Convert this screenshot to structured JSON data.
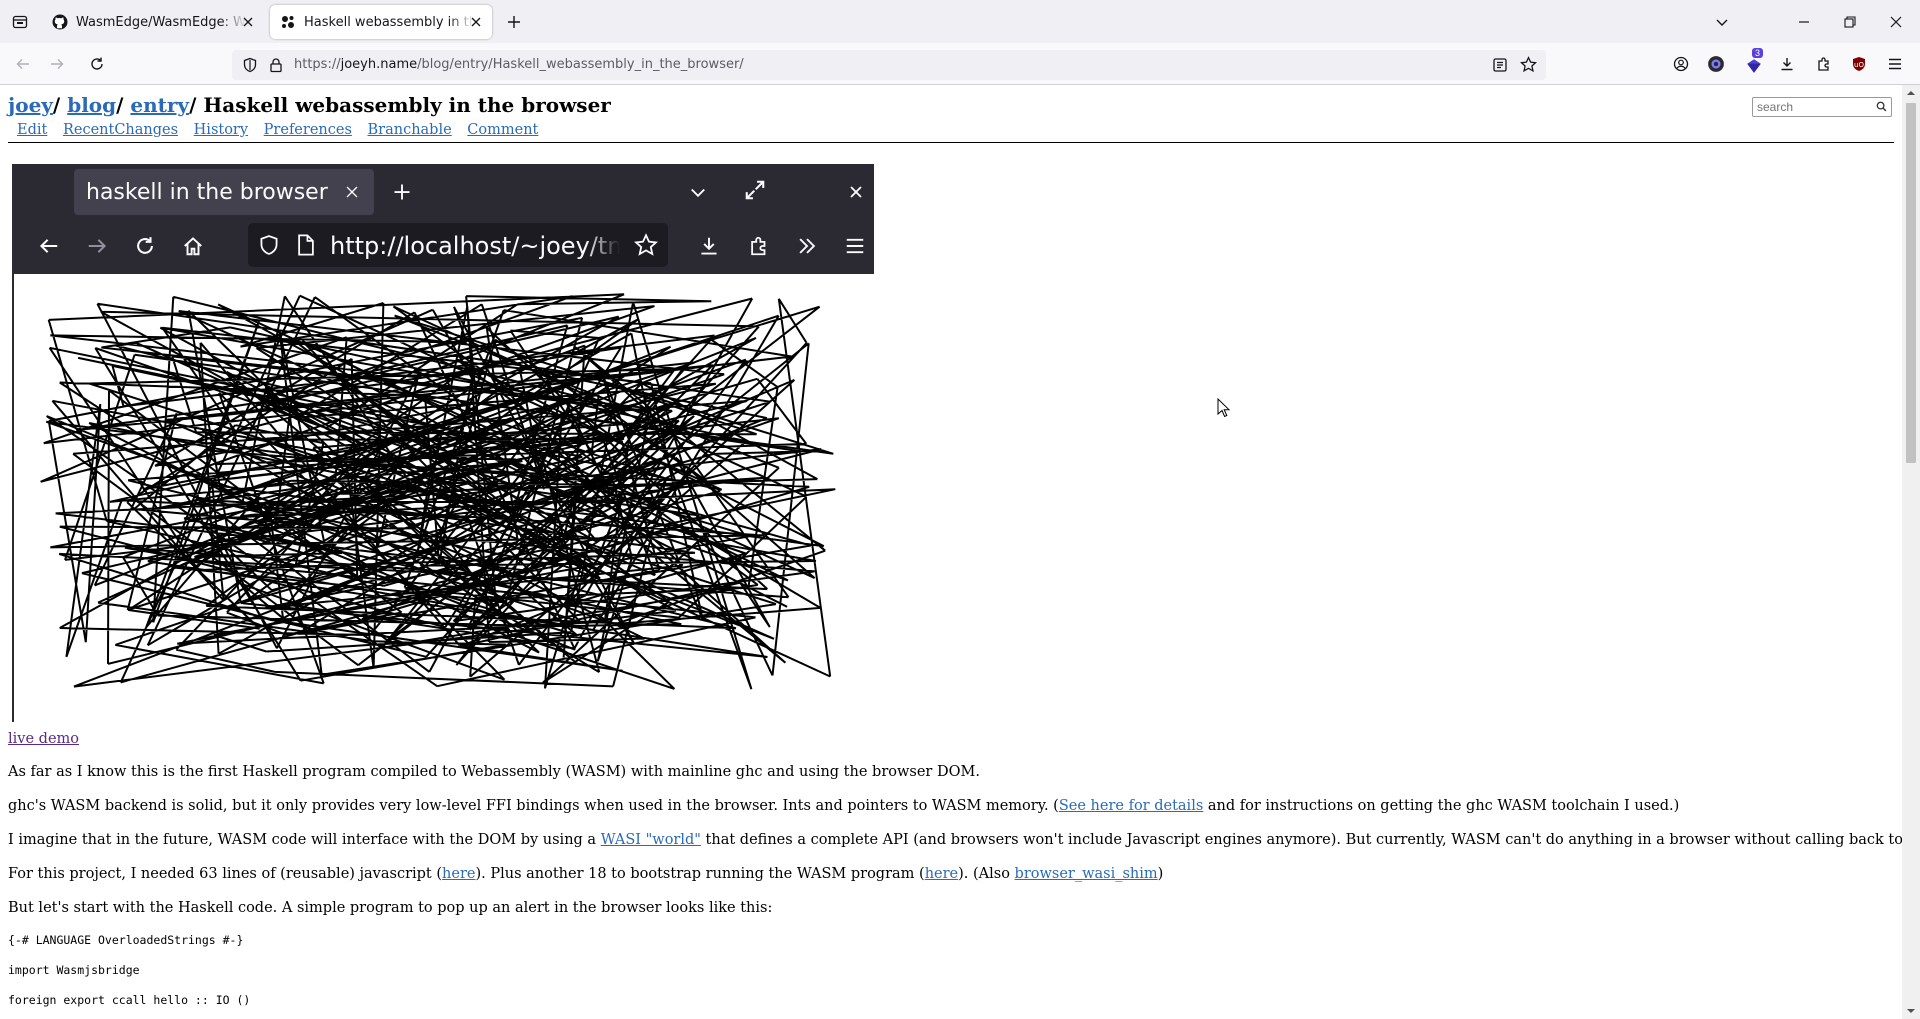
{
  "tabs": [
    {
      "title": "WasmEdge/WasmEdge: WasmEdge is a lightweight",
      "icon": "github-icon"
    },
    {
      "title": "Haskell webassembly in the browser",
      "icon": "ikiwiki-icon"
    }
  ],
  "address": {
    "prefix": "https://",
    "host": "joeyh.name",
    "path": "/blog/entry/Haskell_webassembly_in_the_browser/"
  },
  "extension_badge": "3",
  "breadcrumbs": {
    "joey": "joey",
    "blog": "blog",
    "entry": "entry",
    "sep": "/",
    "title": "Haskell webassembly in the browser"
  },
  "actions": [
    "Edit",
    "RecentChanges",
    "History",
    "Preferences",
    "Branchable",
    "Comment"
  ],
  "search": {
    "placeholder": "search"
  },
  "screenshot": {
    "tab_title": "haskell in the browser",
    "url": "http://localhost/~joey/tmp/"
  },
  "live_demo": "live demo",
  "p1": "As far as I know this is the first Haskell program compiled to Webassembly (WASM) with mainline ghc and using the browser DOM.",
  "p2": {
    "before": "ghc's WASM backend is solid, but it only provides very low-level FFI bindings when used in the browser. Ints and pointers to WASM memory. (",
    "link": "See here for details",
    "after": " and for instructions on getting the ghc WASM toolchain I used.)"
  },
  "p3": {
    "before": "I imagine that in the future, WASM code will interface with the DOM by using a ",
    "link": "WASI \"world\"",
    "after": " that defines a complete API (and browsers won't include Javascript engines anymore). But currently, WASM can't do anything in a browser without calling back to Javascript."
  },
  "p4": {
    "a": "For this project, I needed 63 lines of (reusable) javascript (",
    "link1": "here",
    "b": "). Plus another 18 to bootstrap running the WASM program (",
    "link2": "here",
    "c": "). (Also ",
    "link3": "browser_wasi_shim",
    "d": ")"
  },
  "p5": "But let's start with the Haskell code. A simple program to pop up an alert in the browser looks like this:",
  "code": [
    "{-# LANGUAGE OverloadedStrings #-}",
    "import Wasmjsbridge",
    "foreign export ccall hello :: IO ()"
  ]
}
